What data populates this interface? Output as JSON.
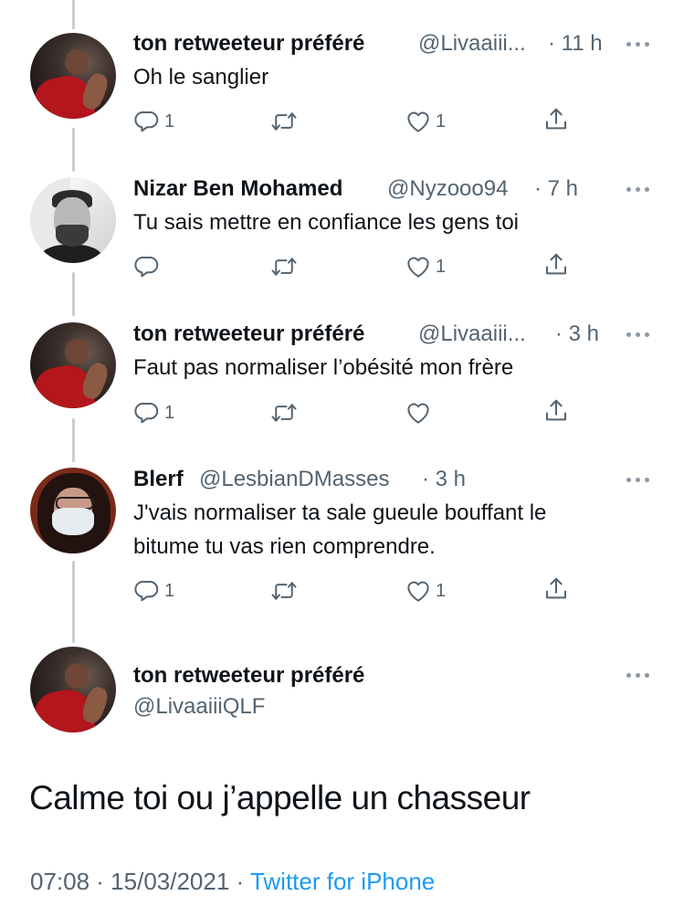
{
  "tweets": [
    {
      "name": "ton retweeteur préféré",
      "handle": "@Livaaiii...",
      "time": "· 11 h",
      "text": [
        "Oh le sanglier"
      ],
      "replies": "1",
      "retweets": "",
      "likes": "1"
    },
    {
      "name": "Nizar Ben Mohamed",
      "handle": "@Nyzooo94",
      "time": "· 7 h",
      "text": [
        "Tu sais mettre en confiance les gens toi"
      ],
      "replies": "",
      "retweets": "",
      "likes": "1"
    },
    {
      "name": "ton retweeteur préféré",
      "handle": "@Livaaiii...",
      "time": "· 3 h",
      "text": [
        "Faut pas normaliser l’obésité mon frère"
      ],
      "replies": "1",
      "retweets": "",
      "likes": ""
    },
    {
      "name": "Blerf",
      "handle": "@LesbianDMasses",
      "time": "· 3 h",
      "text": [
        "J'vais normaliser ta sale gueule bouffant le",
        "bitume tu vas rien comprendre."
      ],
      "replies": "1",
      "retweets": "",
      "likes": "1"
    }
  ],
  "main_tweet": {
    "name": "ton retweeteur préféré",
    "handle": "@LivaaiiiQLF",
    "text": "Calme toi ou j’appelle un chasseur",
    "timestamp": "07:08 · 15/03/2021 ·",
    "source": "Twitter for iPhone"
  },
  "icons": [
    "reply-icon",
    "retweet-icon",
    "like-icon",
    "share-icon",
    "more-icon"
  ],
  "colors": {
    "accent": "#1d9bf0",
    "secondary_text": "#536471",
    "primary_text": "#0f1419",
    "thread_line": "#c4cfd6"
  }
}
